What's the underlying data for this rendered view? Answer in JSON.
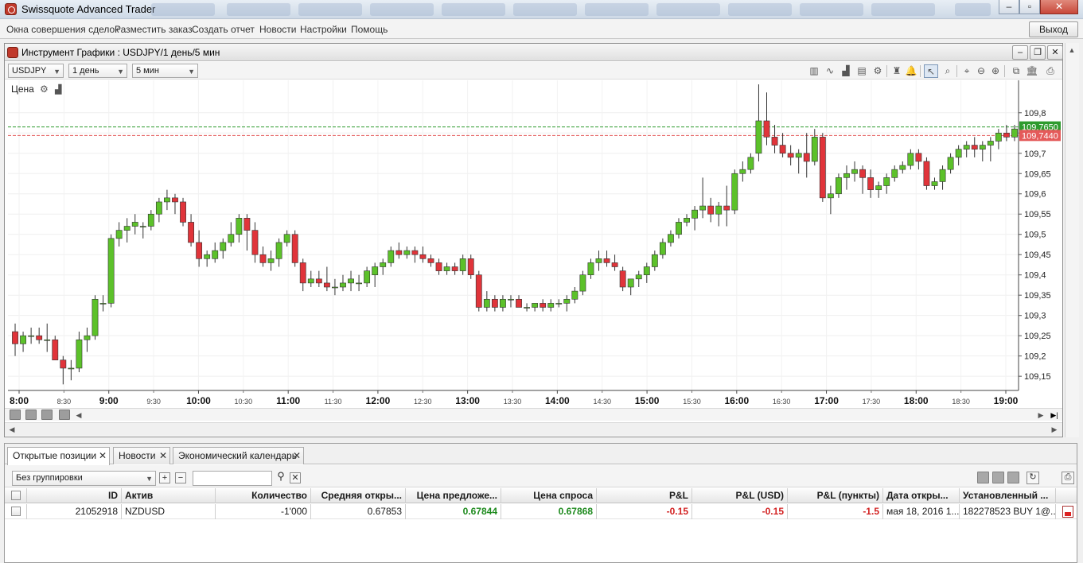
{
  "window": {
    "title": "Swissquote Advanced Trader"
  },
  "menubar": {
    "items": [
      "Окна совершения сделок",
      "Разместить заказ",
      "Создать отчет",
      "Новости",
      "Настройки",
      "Помощь"
    ],
    "exit_label": "Выход"
  },
  "chart_window": {
    "title": "Инструмент Графики : USDJPY/1 день/5 мин",
    "symbol": "USDJPY",
    "period": "1 день",
    "interval": "5 мин",
    "price_label": "Цена"
  },
  "chart_data": {
    "type": "candlestick",
    "x_ticks_major": [
      "8:00",
      "9:00",
      "10:00",
      "11:00",
      "12:00",
      "13:00",
      "14:00",
      "15:00",
      "16:00",
      "17:00",
      "18:00",
      "19:00"
    ],
    "x_ticks_minor": [
      "8:30",
      "9:30",
      "10:30",
      "11:30",
      "12:30",
      "13:30",
      "14:30",
      "15:30",
      "16:30",
      "17:30",
      "18:30"
    ],
    "y_ticks": [
      "109,15",
      "109,2",
      "109,25",
      "109,3",
      "109,35",
      "109,4",
      "109,45",
      "109,5",
      "109,55",
      "109,6",
      "109,65",
      "109,7",
      "109,75",
      "109,8"
    ],
    "ylim": [
      109.115,
      109.88
    ],
    "ask_line": {
      "value": 109.765,
      "label": "109,7650",
      "color": "#2e9b2e"
    },
    "bid_line": {
      "value": 109.744,
      "label": "109,7440",
      "color": "#e45a5a"
    },
    "up_color": "#5cc12a",
    "down_color": "#e0343a",
    "candles": [
      [
        109.26,
        109.28,
        109.2,
        109.23
      ],
      [
        109.23,
        109.26,
        109.21,
        109.25
      ],
      [
        109.25,
        109.27,
        109.23,
        109.25
      ],
      [
        109.25,
        109.27,
        109.23,
        109.24
      ],
      [
        109.24,
        109.28,
        109.21,
        109.24
      ],
      [
        109.24,
        109.25,
        109.19,
        109.19
      ],
      [
        109.19,
        109.2,
        109.13,
        109.17
      ],
      [
        109.17,
        109.19,
        109.14,
        109.17
      ],
      [
        109.17,
        109.26,
        109.16,
        109.24
      ],
      [
        109.24,
        109.27,
        109.21,
        109.25
      ],
      [
        109.25,
        109.35,
        109.24,
        109.34
      ],
      [
        109.33,
        109.35,
        109.31,
        109.33
      ],
      [
        109.33,
        109.5,
        109.32,
        109.49
      ],
      [
        109.49,
        109.53,
        109.47,
        109.51
      ],
      [
        109.51,
        109.54,
        109.48,
        109.52
      ],
      [
        109.52,
        109.55,
        109.5,
        109.53
      ],
      [
        109.52,
        109.53,
        109.49,
        109.52
      ],
      [
        109.52,
        109.56,
        109.51,
        109.55
      ],
      [
        109.55,
        109.59,
        109.53,
        109.58
      ],
      [
        109.58,
        109.61,
        109.56,
        109.59
      ],
      [
        109.59,
        109.6,
        109.55,
        109.58
      ],
      [
        109.58,
        109.59,
        109.52,
        109.53
      ],
      [
        109.53,
        109.55,
        109.47,
        109.48
      ],
      [
        109.48,
        109.51,
        109.42,
        109.44
      ],
      [
        109.44,
        109.46,
        109.42,
        109.45
      ],
      [
        109.44,
        109.48,
        109.43,
        109.46
      ],
      [
        109.46,
        109.49,
        109.44,
        109.48
      ],
      [
        109.48,
        109.53,
        109.47,
        109.5
      ],
      [
        109.5,
        109.55,
        109.48,
        109.54
      ],
      [
        109.54,
        109.55,
        109.46,
        109.51
      ],
      [
        109.51,
        109.53,
        109.43,
        109.45
      ],
      [
        109.45,
        109.47,
        109.42,
        109.43
      ],
      [
        109.43,
        109.46,
        109.41,
        109.44
      ],
      [
        109.44,
        109.49,
        109.42,
        109.48
      ],
      [
        109.48,
        109.51,
        109.47,
        109.5
      ],
      [
        109.5,
        109.51,
        109.42,
        109.43
      ],
      [
        109.43,
        109.44,
        109.36,
        109.38
      ],
      [
        109.38,
        109.41,
        109.37,
        109.39
      ],
      [
        109.39,
        109.41,
        109.37,
        109.38
      ],
      [
        109.38,
        109.42,
        109.36,
        109.37
      ],
      [
        109.37,
        109.39,
        109.35,
        109.37
      ],
      [
        109.37,
        109.4,
        109.36,
        109.38
      ],
      [
        109.38,
        109.41,
        109.36,
        109.39
      ],
      [
        109.38,
        109.4,
        109.36,
        109.38
      ],
      [
        109.38,
        109.42,
        109.37,
        109.41
      ],
      [
        109.4,
        109.43,
        109.37,
        109.42
      ],
      [
        109.42,
        109.44,
        109.4,
        109.43
      ],
      [
        109.43,
        109.47,
        109.42,
        109.46
      ],
      [
        109.46,
        109.48,
        109.44,
        109.45
      ],
      [
        109.45,
        109.47,
        109.44,
        109.46
      ],
      [
        109.46,
        109.47,
        109.43,
        109.45
      ],
      [
        109.45,
        109.47,
        109.43,
        109.44
      ],
      [
        109.44,
        109.45,
        109.42,
        109.43
      ],
      [
        109.43,
        109.44,
        109.4,
        109.41
      ],
      [
        109.41,
        109.43,
        109.4,
        109.42
      ],
      [
        109.42,
        109.43,
        109.4,
        109.41
      ],
      [
        109.41,
        109.45,
        109.4,
        109.44
      ],
      [
        109.44,
        109.45,
        109.39,
        109.4
      ],
      [
        109.4,
        109.41,
        109.31,
        109.32
      ],
      [
        109.32,
        109.36,
        109.31,
        109.34
      ],
      [
        109.34,
        109.35,
        109.31,
        109.32
      ],
      [
        109.32,
        109.35,
        109.31,
        109.34
      ],
      [
        109.34,
        109.35,
        109.32,
        109.34
      ],
      [
        109.34,
        109.35,
        109.32,
        109.32
      ],
      [
        109.32,
        109.33,
        109.31,
        109.32
      ],
      [
        109.32,
        109.33,
        109.31,
        109.33
      ],
      [
        109.33,
        109.34,
        109.31,
        109.32
      ],
      [
        109.32,
        109.34,
        109.31,
        109.33
      ],
      [
        109.33,
        109.34,
        109.32,
        109.33
      ],
      [
        109.33,
        109.35,
        109.31,
        109.34
      ],
      [
        109.34,
        109.37,
        109.33,
        109.36
      ],
      [
        109.36,
        109.41,
        109.35,
        109.4
      ],
      [
        109.4,
        109.44,
        109.39,
        109.43
      ],
      [
        109.43,
        109.46,
        109.41,
        109.44
      ],
      [
        109.44,
        109.46,
        109.42,
        109.43
      ],
      [
        109.43,
        109.45,
        109.41,
        109.42
      ],
      [
        109.41,
        109.42,
        109.36,
        109.37
      ],
      [
        109.37,
        109.39,
        109.35,
        109.39
      ],
      [
        109.39,
        109.41,
        109.37,
        109.4
      ],
      [
        109.4,
        109.43,
        109.38,
        109.42
      ],
      [
        109.42,
        109.46,
        109.41,
        109.45
      ],
      [
        109.45,
        109.49,
        109.44,
        109.48
      ],
      [
        109.48,
        109.51,
        109.47,
        109.5
      ],
      [
        109.5,
        109.54,
        109.49,
        109.53
      ],
      [
        109.53,
        109.55,
        109.52,
        109.54
      ],
      [
        109.54,
        109.57,
        109.51,
        109.56
      ],
      [
        109.56,
        109.64,
        109.54,
        109.57
      ],
      [
        109.57,
        109.59,
        109.53,
        109.55
      ],
      [
        109.55,
        109.58,
        109.52,
        109.57
      ],
      [
        109.57,
        109.62,
        109.52,
        109.56
      ],
      [
        109.56,
        109.66,
        109.55,
        109.65
      ],
      [
        109.65,
        109.68,
        109.63,
        109.66
      ],
      [
        109.66,
        109.7,
        109.65,
        109.69
      ],
      [
        109.7,
        109.87,
        109.68,
        109.78
      ],
      [
        109.78,
        109.85,
        109.72,
        109.74
      ],
      [
        109.74,
        109.77,
        109.7,
        109.72
      ],
      [
        109.72,
        109.75,
        109.69,
        109.7
      ],
      [
        109.7,
        109.72,
        109.67,
        109.69
      ],
      [
        109.69,
        109.71,
        109.65,
        109.7
      ],
      [
        109.7,
        109.75,
        109.64,
        109.68
      ],
      [
        109.68,
        109.76,
        109.67,
        109.74
      ],
      [
        109.74,
        109.75,
        109.58,
        109.59
      ],
      [
        109.59,
        109.62,
        109.55,
        109.6
      ],
      [
        109.6,
        109.65,
        109.59,
        109.64
      ],
      [
        109.64,
        109.67,
        109.61,
        109.65
      ],
      [
        109.65,
        109.68,
        109.63,
        109.66
      ],
      [
        109.66,
        109.67,
        109.6,
        109.64
      ],
      [
        109.64,
        109.66,
        109.59,
        109.61
      ],
      [
        109.61,
        109.63,
        109.59,
        109.62
      ],
      [
        109.62,
        109.65,
        109.6,
        109.64
      ],
      [
        109.64,
        109.67,
        109.63,
        109.66
      ],
      [
        109.66,
        109.68,
        109.65,
        109.67
      ],
      [
        109.67,
        109.71,
        109.66,
        109.7
      ],
      [
        109.7,
        109.71,
        109.66,
        109.68
      ],
      [
        109.68,
        109.69,
        109.61,
        109.62
      ],
      [
        109.62,
        109.64,
        109.61,
        109.63
      ],
      [
        109.63,
        109.67,
        109.61,
        109.66
      ],
      [
        109.66,
        109.7,
        109.65,
        109.69
      ],
      [
        109.69,
        109.72,
        109.67,
        109.71
      ],
      [
        109.71,
        109.73,
        109.69,
        109.72
      ],
      [
        109.72,
        109.74,
        109.69,
        109.71
      ],
      [
        109.71,
        109.73,
        109.68,
        109.72
      ],
      [
        109.72,
        109.74,
        109.68,
        109.73
      ],
      [
        109.73,
        109.76,
        109.71,
        109.75
      ],
      [
        109.75,
        109.77,
        109.73,
        109.74
      ],
      [
        109.74,
        109.77,
        109.73,
        109.76
      ]
    ]
  },
  "bottom_panel": {
    "tabs": [
      "Открытые позиции",
      "Новости",
      "Экономический календарь"
    ],
    "grouping": "Без группировки",
    "search_placeholder": "",
    "table": {
      "headers": [
        "ID",
        "Актив",
        "Количество",
        "Средняя откры...",
        "Цена предложе...",
        "Цена спроса",
        "P&L",
        "P&L (USD)",
        "P&L (пункты)",
        "Дата откры...",
        "Установленный ..."
      ],
      "rows": [
        [
          "21052918",
          "NZDUSD",
          "-1'000",
          "0.67853",
          "0.67844",
          "0.67868",
          "-0.15",
          "-0.15",
          "-1.5",
          "мая 18, 2016 1...",
          "182278523 BUY 1@..."
        ]
      ]
    }
  }
}
